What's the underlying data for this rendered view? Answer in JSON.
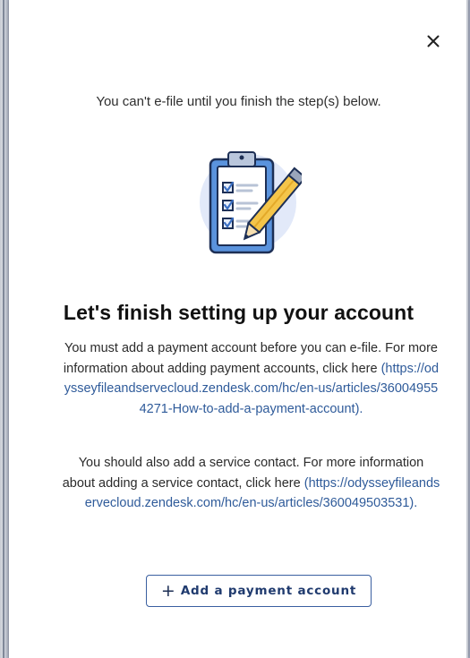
{
  "modal": {
    "intro_text": "You can't e-file until you finish the step(s) below.",
    "illustration_icon": "clipboard-checklist-pencil-icon",
    "close_icon": "close-icon",
    "title": "Let's finish setting up your account",
    "paragraph1": {
      "text": "You must add a payment account before you can e-file. For more information about adding payment accounts, click here",
      "link_text": "(https://odysseyfileandservecloud.zendesk.com/hc/en-us/articles/360049554271-How-to-add-a-payment-account)."
    },
    "paragraph2": {
      "text": "You should also add a service contact. For more information about adding a service contact, click here",
      "link_text": "(https://odysseyfileandservecloud.zendesk.com/hc/en-us/articles/360049503531)."
    },
    "primary_button": {
      "icon": "plus-icon",
      "label": "Add a payment account"
    }
  },
  "colors": {
    "link": "#2f5b9a",
    "button_border": "#3a5fa0",
    "button_text": "#1f3a6e",
    "clipboard_blue": "#4e88d6",
    "circle_bg": "#e2e9f9"
  }
}
